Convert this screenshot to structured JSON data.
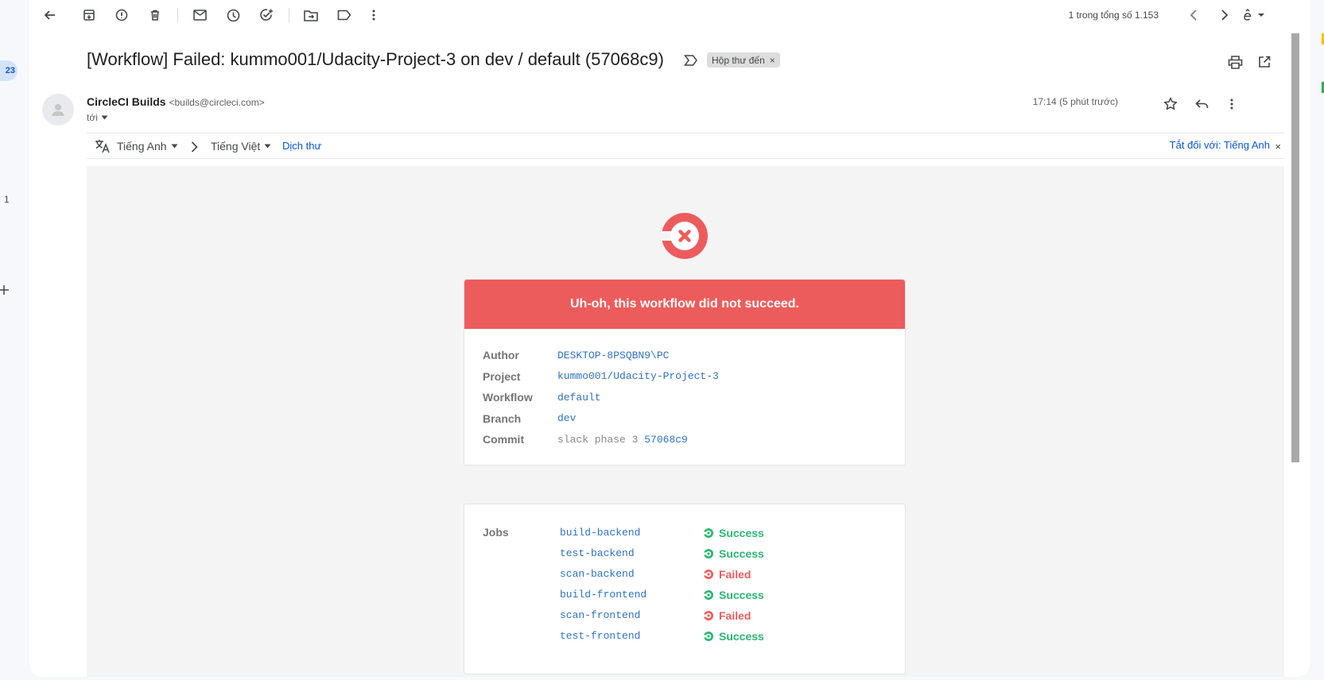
{
  "rail": {
    "badge": "23",
    "count": "1"
  },
  "toolbar": {
    "pager": "1 trong tổng số 1.153"
  },
  "subject": {
    "title": "[Workflow] Failed: kummo001/Udacity-Project-3 on dev / default (57068c9)",
    "label": "Hộp thư đến",
    "label_remove": "×"
  },
  "message": {
    "sender_name": "CircleCI Builds",
    "sender_email": "<builds@circleci.com>",
    "to": "tới",
    "time": "17:14 (5 phút trước)"
  },
  "translate": {
    "from_lang": "Tiếng Anh",
    "to_lang": "Tiếng Việt",
    "translate_link": "Dịch thư",
    "turn_off": "Tắt đối với: Tiếng Anh",
    "close": "×"
  },
  "email": {
    "banner": "Uh-oh, this workflow did not succeed.",
    "info": [
      {
        "key": "Author",
        "value": "DESKTOP-8PSQBN9\\PC"
      },
      {
        "key": "Project",
        "value": "kummo001/Udacity-Project-3"
      },
      {
        "key": "Workflow",
        "value": "default"
      },
      {
        "key": "Branch",
        "value": "dev"
      }
    ],
    "commit": {
      "key": "Commit",
      "message": "slack phase 3",
      "hash": "57068c9"
    },
    "jobs_label": "Jobs",
    "jobs": [
      {
        "name": "build-backend",
        "status": "Success"
      },
      {
        "name": "test-backend",
        "status": "Success"
      },
      {
        "name": "scan-backend",
        "status": "Failed"
      },
      {
        "name": "build-frontend",
        "status": "Success"
      },
      {
        "name": "scan-frontend",
        "status": "Failed"
      },
      {
        "name": "test-frontend",
        "status": "Success"
      }
    ]
  },
  "colors": {
    "fail_red": "#ed5c5c",
    "success_green": "#2bb673",
    "link_blue": "#2f72c0"
  }
}
